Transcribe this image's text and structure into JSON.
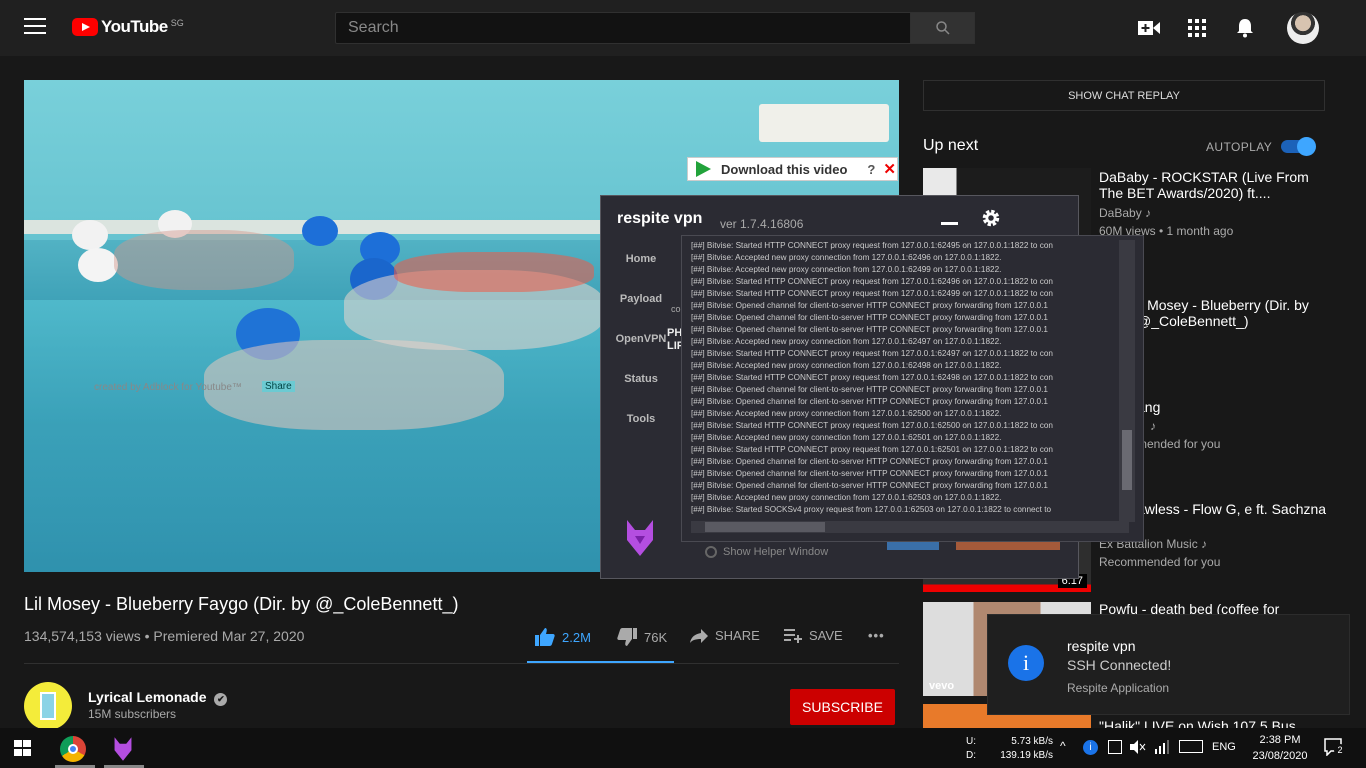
{
  "header": {
    "logo_text": "YouTube",
    "region": "SG",
    "search_placeholder": "Search"
  },
  "video": {
    "download_bar_label": "Download this video",
    "download_help": "?",
    "download_close": "✕",
    "title": "Lil Mosey - Blueberry Faygo (Dir. by @_ColeBennett_)",
    "views_line": "134,574,153 views • Premiered Mar 27, 2020",
    "likes": "2.2M",
    "dislikes": "76K",
    "share_label": "SHARE",
    "save_label": "SAVE",
    "more_label": "•••"
  },
  "channel": {
    "name": "Lyrical Lemonade",
    "verified_icon": "✔",
    "subscribers": "15M subscribers",
    "subscribe_label": "SUBSCRIBE"
  },
  "sidebar": {
    "chat_replay_label": "SHOW CHAT REPLAY",
    "up_next_label": "Up next",
    "autoplay_label": "AUTOPLAY",
    "autoplay_on": true,
    "items": [
      {
        "title": "DaBaby - ROCKSTAR (Live From The BET Awards/2020) ft....",
        "channel": "DaBaby ♪",
        "meta": "60M views • 1 month ago"
      },
      {
        "title": "ll Mosey - Blueberry (Dir. by @_ColeBennett_)",
        "channel": "e",
        "meta": ""
      },
      {
        "title": "ang",
        "channel": "♪",
        "meta": "mended for you"
      },
      {
        "title": "awless - Flow G, e ft. Sachzna",
        "channel": "Ex Battalion Music ♪",
        "meta": "Recommended for you",
        "duration": "6:17"
      },
      {
        "title": "Powfu - death bed (coffee for",
        "channel": "",
        "meta": ""
      },
      {
        "title": "\"Halik\" LIVE on Wish 107.5 Bus",
        "channel": "",
        "meta": ""
      }
    ]
  },
  "vpn": {
    "title": "respite vpn",
    "version": "ver 1.7.4.16806",
    "nav": [
      "Home",
      "Payload",
      "OpenVPN",
      "Status",
      "Tools"
    ],
    "mid_text": "PH\nLIF",
    "mid_label": "co",
    "helper_label": "Show Helper Window",
    "made_by": "created by Adblock for Youtube™",
    "share_label": "Share",
    "log": [
      "[##] Bitvise: Started HTTP CONNECT proxy request from 127.0.0.1:62495 on 127.0.0.1:1822 to con",
      "[##] Bitvise: Accepted new proxy connection from 127.0.0.1:62496 on 127.0.0.1:1822.",
      "[##] Bitvise: Accepted new proxy connection from 127.0.0.1:62499 on 127.0.0.1:1822.",
      "[##] Bitvise: Started HTTP CONNECT proxy request from 127.0.0.1:62496 on 127.0.0.1:1822 to con",
      "[##] Bitvise: Started HTTP CONNECT proxy request from 127.0.0.1:62499 on 127.0.0.1:1822 to con",
      "[##] Bitvise: Opened channel for client-to-server HTTP CONNECT proxy forwarding from 127.0.0.1",
      "[##] Bitvise: Opened channel for client-to-server HTTP CONNECT proxy forwarding from 127.0.0.1",
      "[##] Bitvise: Opened channel for client-to-server HTTP CONNECT proxy forwarding from 127.0.0.1",
      "[##] Bitvise: Accepted new proxy connection from 127.0.0.1:62497 on 127.0.0.1:1822.",
      "[##] Bitvise: Started HTTP CONNECT proxy request from 127.0.0.1:62497 on 127.0.0.1:1822 to con",
      "[##] Bitvise: Accepted new proxy connection from 127.0.0.1:62498 on 127.0.0.1:1822.",
      "[##] Bitvise: Started HTTP CONNECT proxy request from 127.0.0.1:62498 on 127.0.0.1:1822 to con",
      "[##] Bitvise: Opened channel for client-to-server HTTP CONNECT proxy forwarding from 127.0.0.1",
      "[##] Bitvise: Opened channel for client-to-server HTTP CONNECT proxy forwarding from 127.0.0.1",
      "[##] Bitvise: Accepted new proxy connection from 127.0.0.1:62500 on 127.0.0.1:1822.",
      "[##] Bitvise: Started HTTP CONNECT proxy request from 127.0.0.1:62500 on 127.0.0.1:1822 to con",
      "[##] Bitvise: Accepted new proxy connection from 127.0.0.1:62501 on 127.0.0.1:1822.",
      "[##] Bitvise: Started HTTP CONNECT proxy request from 127.0.0.1:62501 on 127.0.0.1:1822 to con",
      "[##] Bitvise: Opened channel for client-to-server HTTP CONNECT proxy forwarding from 127.0.0.1",
      "[##] Bitvise: Opened channel for client-to-server HTTP CONNECT proxy forwarding from 127.0.0.1",
      "[##] Bitvise: Opened channel for client-to-server HTTP CONNECT proxy forwarding from 127.0.0.1",
      "[##] Bitvise: Accepted new proxy connection from 127.0.0.1:62503 on 127.0.0.1:1822.",
      "[##] Bitvise: Started SOCKSv4 proxy request from 127.0.0.1:62503 on 127.0.0.1:1822 to connect to"
    ]
  },
  "notification": {
    "title": "respite vpn",
    "body": "SSH Connected!",
    "app": "Respite Application",
    "icon": "i"
  },
  "taskbar": {
    "net_up_label": "U:",
    "net_down_label": "D:",
    "net_up": "5.73 kB/s",
    "net_down": "139.19 kB/s",
    "language": "ENG",
    "time": "2:38 PM",
    "date": "23/08/2020",
    "notif_count": "2"
  },
  "colors": {
    "accent_blue": "#3ea6ff",
    "subscribe_red": "#cc0000",
    "youtube_red": "#ff0000"
  }
}
